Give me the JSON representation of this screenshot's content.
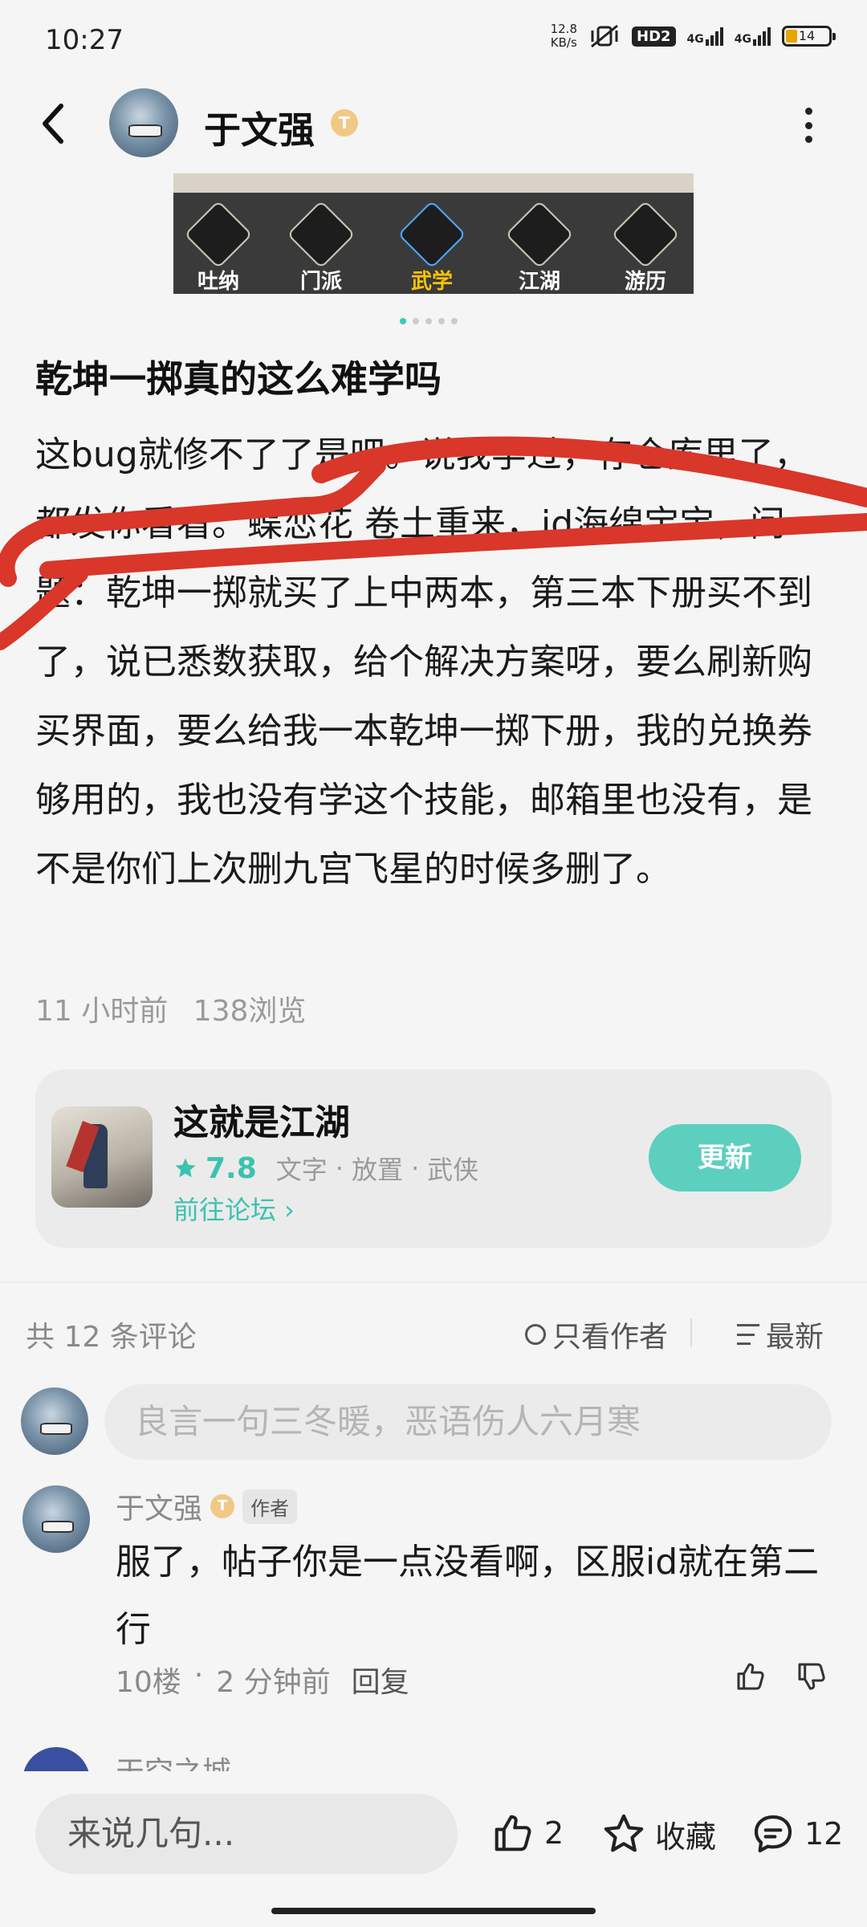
{
  "status_bar": {
    "time": "10:27",
    "net_speed_value": "12.8",
    "net_speed_unit": "KB/s",
    "hd": "HD2",
    "signal1": "4G",
    "signal2": "4G",
    "battery": "14"
  },
  "header": {
    "author_name": "于文强",
    "level_badge": "T"
  },
  "banner": {
    "items": [
      "吐纳",
      "门派",
      "武学",
      "江湖",
      "游历"
    ]
  },
  "post": {
    "title": "乾坤一掷真的这么难学吗",
    "body": "这bug就修不了了是吧。说我学过，存仓库里了，都发你看看。蝶恋花 卷土重来，id海绵宝宝，问题：乾坤一掷就买了上中两本，第三本下册买不到了，说已悉数获取，给个解决方案呀，要么刷新购买界面，要么给我一本乾坤一掷下册，我的兑换券够用的，我也没有学这个技能，邮箱里也没有，是不是你们上次删九宫飞星的时候多删了。",
    "time": "11 小时前",
    "views": "138浏览"
  },
  "game_card": {
    "name": "这就是江湖",
    "score": "7.8",
    "tags": [
      "文字",
      "放置",
      "武侠"
    ],
    "tag_sep": "·",
    "forum_link": "前往论坛 ›",
    "button": "更新"
  },
  "comments_header": {
    "count": "共 12 条评论",
    "author_only": "只看作者",
    "sort": "最新"
  },
  "comment_input": {
    "placeholder": "良言一句三冬暖，恶语伤人六月寒"
  },
  "comments": [
    {
      "name": "于文强",
      "badge": "T",
      "tag": "作者",
      "body": "服了，帖子你是一点没看啊，区服id就在第二行",
      "floor": "10楼",
      "dot": "·",
      "time": "2 分钟前",
      "reply": "回复"
    }
  ],
  "next_comment_name": "天空之城",
  "bottom_bar": {
    "input_placeholder": "来说几句...",
    "likes": "2",
    "favorite": "收藏",
    "comments": "12"
  }
}
